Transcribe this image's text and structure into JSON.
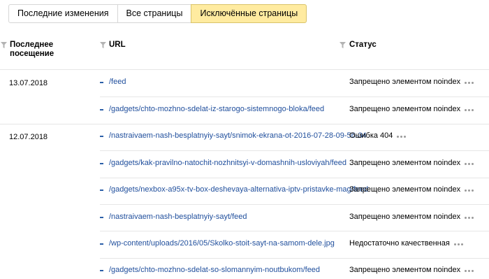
{
  "tabs": [
    {
      "label": "Последние изменения",
      "active": false
    },
    {
      "label": "Все страницы",
      "active": false
    },
    {
      "label": "Исключённые страницы",
      "active": true
    }
  ],
  "columns": {
    "last_visit": "Последнее посещение",
    "url": "URL",
    "status": "Статус"
  },
  "groups": [
    {
      "date": "13.07.2018",
      "rows": [
        {
          "url": "/feed",
          "status": "Запрещено элементом noindex"
        },
        {
          "url": "/gadgets/chto-mozhno-sdelat-iz-starogo-sistemnogo-bloka/feed",
          "status": "Запрещено элементом noindex"
        }
      ]
    },
    {
      "date": "12.07.2018",
      "rows": [
        {
          "url": "/nastraivaem-nash-besplatnyiy-sayt/snimok-ekrana-ot-2016-07-28-09-56-34",
          "status": "Ошибка 404"
        },
        {
          "url": "/gadgets/kak-pravilno-natochit-nozhnitsyi-v-domashnih-usloviyah/feed",
          "status": "Запрещено элементом noindex"
        },
        {
          "url": "/gadgets/nexbox-a95x-tv-box-deshevaya-alternativa-iptv-pristavke-mag/feed",
          "status": "Запрещено элементом noindex"
        },
        {
          "url": "/nastraivaem-nash-besplatnyiy-sayt/feed",
          "status": "Запрещено элементом noindex"
        },
        {
          "url": "/wp-content/uploads/2016/05/Skolko-stoit-sayt-na-samom-dele.jpg",
          "status": "Недостаточно качественная"
        },
        {
          "url": "/gadgets/chto-mozhno-sdelat-so-slomannyim-noutbukom/feed",
          "status": "Запрещено элементом noindex"
        }
      ]
    }
  ]
}
